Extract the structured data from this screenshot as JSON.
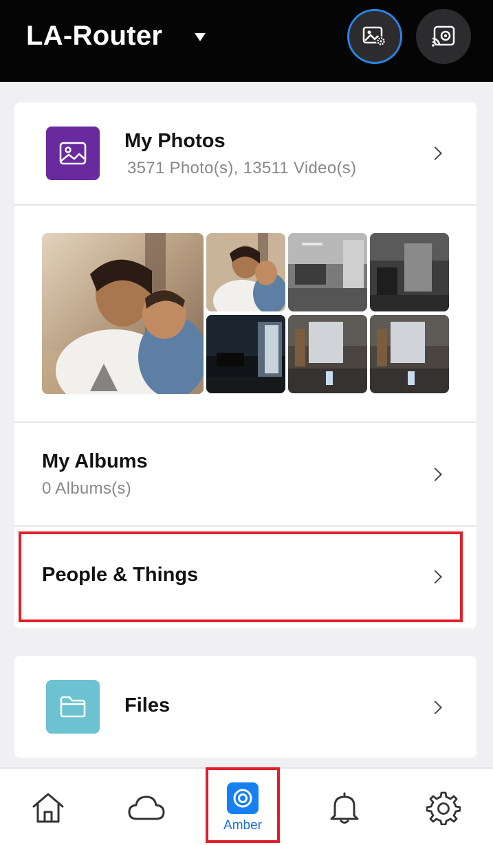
{
  "header": {
    "router_name": "LA-Router",
    "icons": [
      "photo-settings-icon",
      "cast-icon"
    ],
    "accent_color": "#2a83e6"
  },
  "my_photos": {
    "title": "My Photos",
    "subtitle": "3571 Photo(s), 13511 Video(s)",
    "icon": "image-icon",
    "tile_color": "#6a2a9f",
    "thumbnails": [
      {
        "name": "mother-and-child-photo"
      },
      {
        "name": "mother-and-child-photo-small"
      },
      {
        "name": "office-camera-frame-1"
      },
      {
        "name": "office-camera-frame-2"
      },
      {
        "name": "office-camera-frame-night"
      },
      {
        "name": "office-camera-frame-3"
      },
      {
        "name": "office-camera-frame-4"
      }
    ]
  },
  "my_albums": {
    "title": "My Albums",
    "subtitle": "0 Albums(s)"
  },
  "people_things": {
    "title": "People & Things",
    "highlight_color": "#e0202a"
  },
  "files": {
    "title": "Files",
    "icon": "folder-icon",
    "tile_color": "#6cc2d0"
  },
  "bottom_nav": {
    "items": [
      {
        "name": "home",
        "icon": "home-icon"
      },
      {
        "name": "cloud",
        "icon": "cloud-icon"
      },
      {
        "name": "amber",
        "icon": "amber-icon",
        "label": "Amber",
        "active": true
      },
      {
        "name": "notifications",
        "icon": "bell-icon"
      },
      {
        "name": "settings",
        "icon": "gear-icon"
      }
    ],
    "active_color": "#1680f0"
  }
}
